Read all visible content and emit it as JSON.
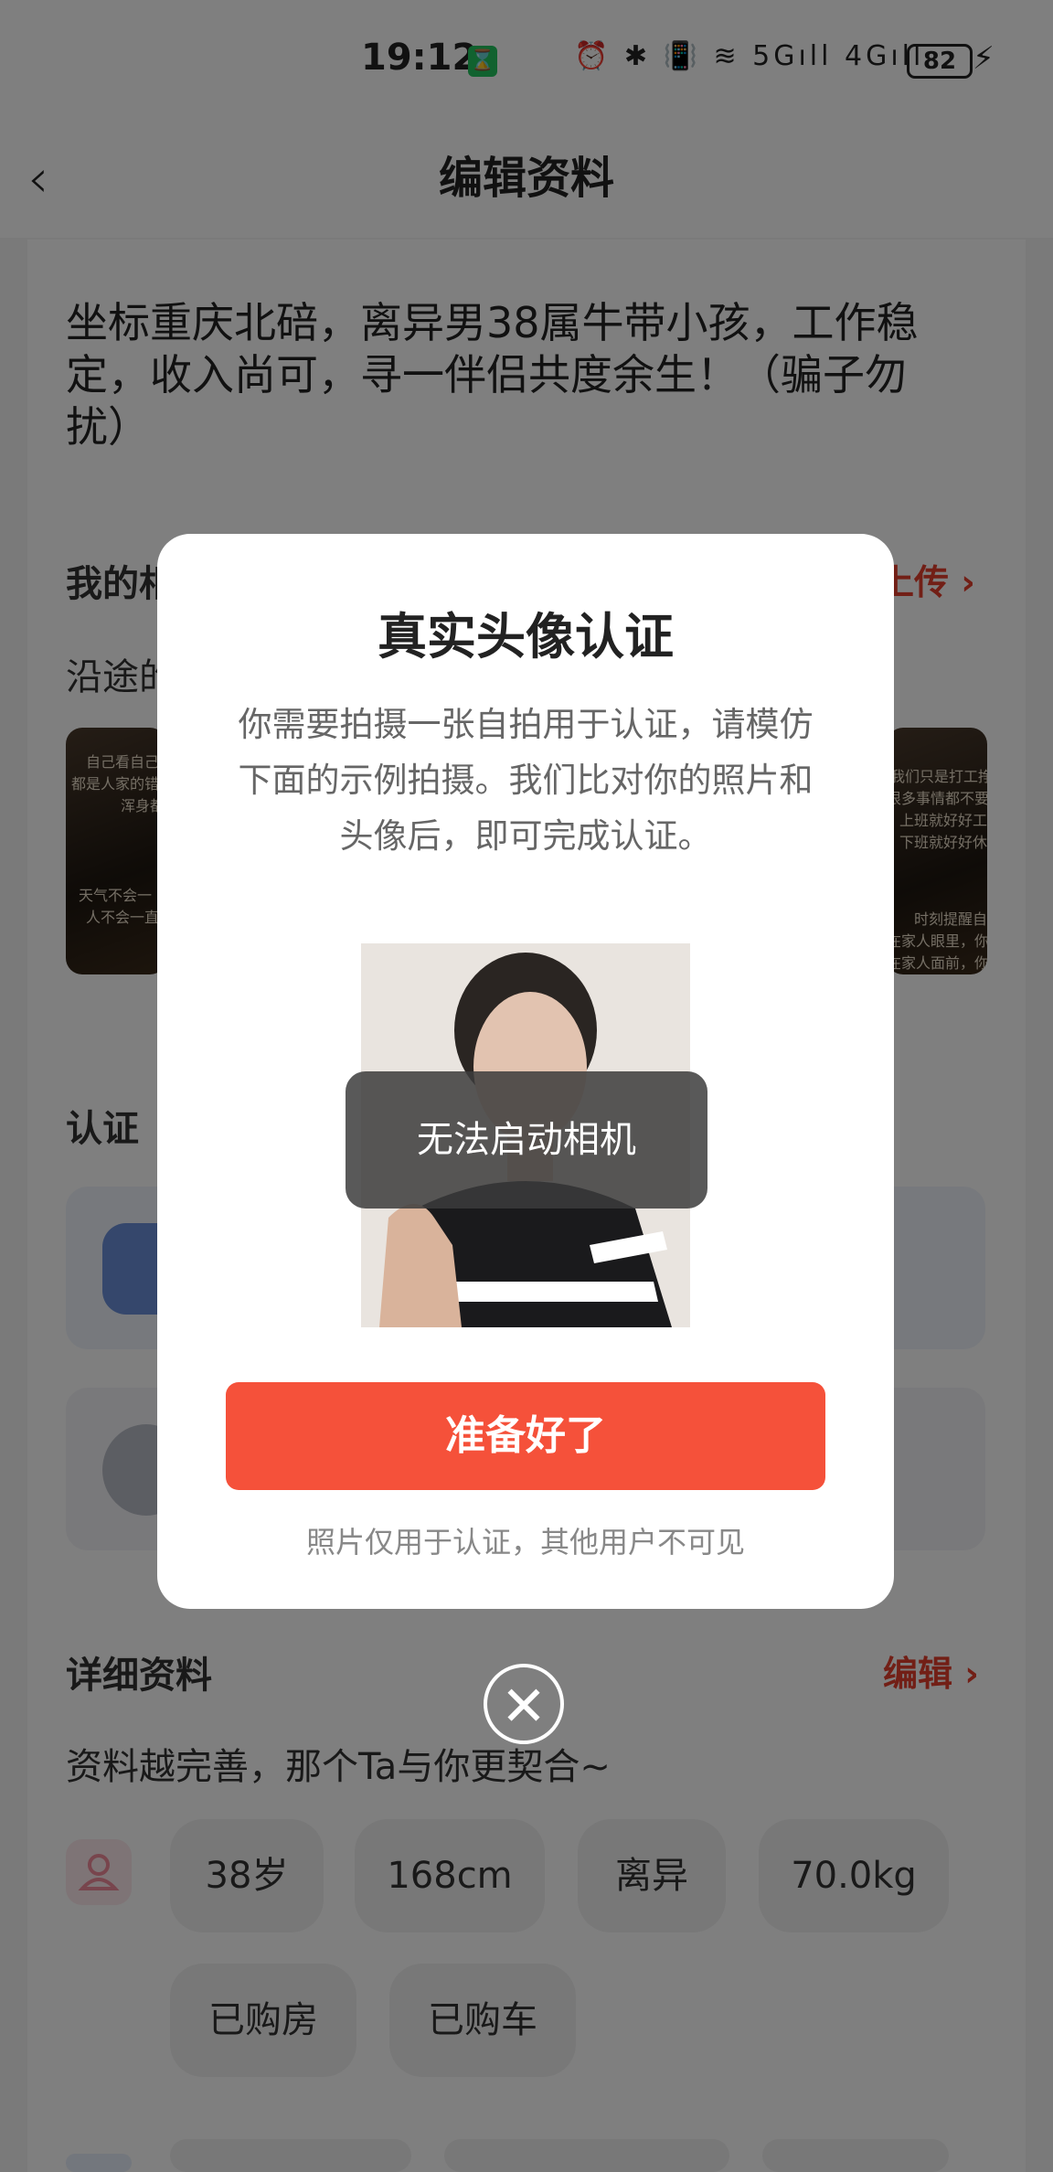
{
  "status_bar": {
    "time": "19:12",
    "timer_icon": "⌛",
    "icons": "⏰ ✱ 📳 ≋ 5Gıll 4Gıll",
    "battery": "82",
    "charging_icon": "⚡"
  },
  "header": {
    "back_icon": "‹",
    "title": "编辑资料"
  },
  "profile": {
    "intro": "坐标重庆北碚，离异男38属牛带小孩，工作稳定，收入尚可，寻一伴侣共度余生！（骗子勿扰）",
    "photos_section": {
      "title_partial": "我的相",
      "link_partial": "上传",
      "subtitle_partial": "沿途的"
    },
    "thumb_left_text": [
      "自己看自己",
      "都是人家的错",
      "浑身都",
      "天气不会一",
      "人不会一直"
    ],
    "thumb_right_text": [
      "我们只是打工挣点",
      "很多事情都不要太",
      "上班就好好工作",
      "下班就好好休息",
      "时刻提醒自己",
      "在家人眼里，你什么",
      "在家人面前，你就是"
    ],
    "cert_section": {
      "title": "认证"
    },
    "details_section": {
      "title": "详细资料",
      "link": "编辑",
      "subtitle": "资料越完善，那个Ta与你更契合~"
    },
    "tags_row1": [
      "38岁",
      "168cm",
      "离异",
      "70.0kg"
    ],
    "tags_row2": [
      "已购房",
      "已购车"
    ]
  },
  "modal": {
    "title": "真实头像认证",
    "description": "你需要拍摄一张自拍用于认证，请模仿下面的示例拍摄。我们比对你的照片和头像后，即可完成认证。",
    "camera_error": "无法启动相机",
    "ready_button": "准备好了",
    "privacy_note": "照片仅用于认证，其他用户不可见",
    "close_icon": "✕"
  },
  "colors": {
    "accent": "#f5513a",
    "link": "#e53e2d",
    "overlay": "rgba(0,0,0,0.5)"
  }
}
